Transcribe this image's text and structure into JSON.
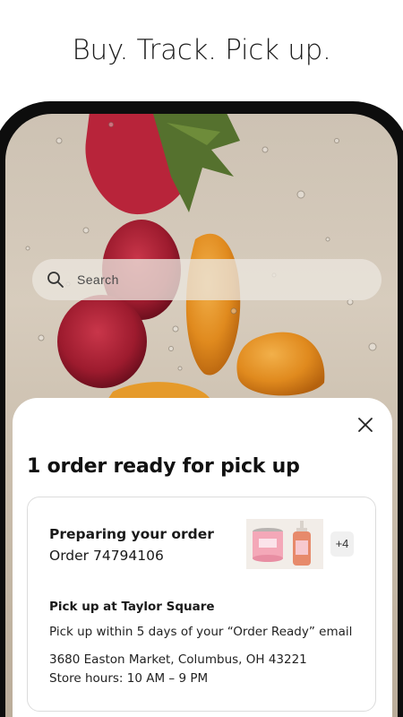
{
  "headline": "Buy. Track. Pick up.",
  "search": {
    "placeholder": "Search"
  },
  "sheet": {
    "title": "1 order ready for pick up",
    "order_card": {
      "status": "Preparing your order",
      "order_number": "Order 74794106",
      "extra_items": "+4",
      "pickup_location": "Pick up at Taylor Square",
      "pickup_window": "Pick up within 5 days of your “Order Ready” email",
      "address": "3680 Easton Market, Columbus, OH 43221",
      "store_hours": "Store hours: 10 AM – 9 PM"
    }
  },
  "icons": {
    "search": "search-icon",
    "close": "close-icon"
  },
  "colors": {
    "accent_text": "#1a1a1a",
    "phone_frame": "#0d0d0d",
    "card_border": "#dcdcdc"
  }
}
